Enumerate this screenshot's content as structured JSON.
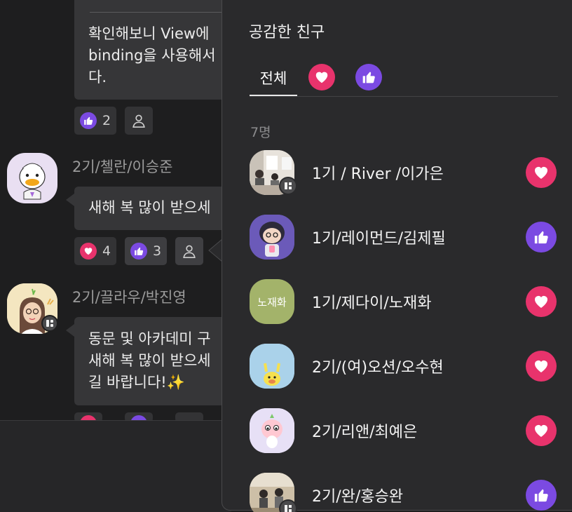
{
  "chat": {
    "messages": [
      {
        "lines": [
          "확인해보니 View에",
          "binding을 사용해서",
          "다."
        ],
        "reactions": {
          "thumb_count": "2"
        }
      },
      {
        "sender": "2기/첼란/이승준",
        "lines": [
          "새해 복 많이 받으세"
        ],
        "reactions": {
          "heart_count": "4",
          "thumb_count": "3"
        }
      },
      {
        "sender": "2기/끌라우/박진영",
        "lines": [
          "동문 및 아카데미 구",
          "새해 복 많이 받으세",
          "길 바랍니다!✨"
        ]
      }
    ]
  },
  "popover": {
    "title": "공감한 친구",
    "tabs": {
      "all": "전체",
      "heart": "heart-icon",
      "thumb": "thumbs-up-icon"
    },
    "count": "7명",
    "friends": [
      {
        "name": "1기 / River /이가은",
        "reaction": "heart",
        "workspace_badge": true
      },
      {
        "name": "1기/레이먼드/김제필",
        "reaction": "thumb",
        "workspace_badge": false
      },
      {
        "name": "1기/제다이/노재화",
        "reaction": "heart",
        "workspace_badge": false,
        "avatar_text": "노재화"
      },
      {
        "name": "2기/(여)오션/오수현",
        "reaction": "heart",
        "workspace_badge": false
      },
      {
        "name": "2기/리앤/최예은",
        "reaction": "heart",
        "workspace_badge": false
      },
      {
        "name": "2기/완/홍승완",
        "reaction": "thumb",
        "workspace_badge": true
      }
    ]
  },
  "colors": {
    "heart": "#e8336c",
    "thumb": "#7b4ae2",
    "background": "#1e1e1f",
    "popover": "#2a2a2c"
  }
}
